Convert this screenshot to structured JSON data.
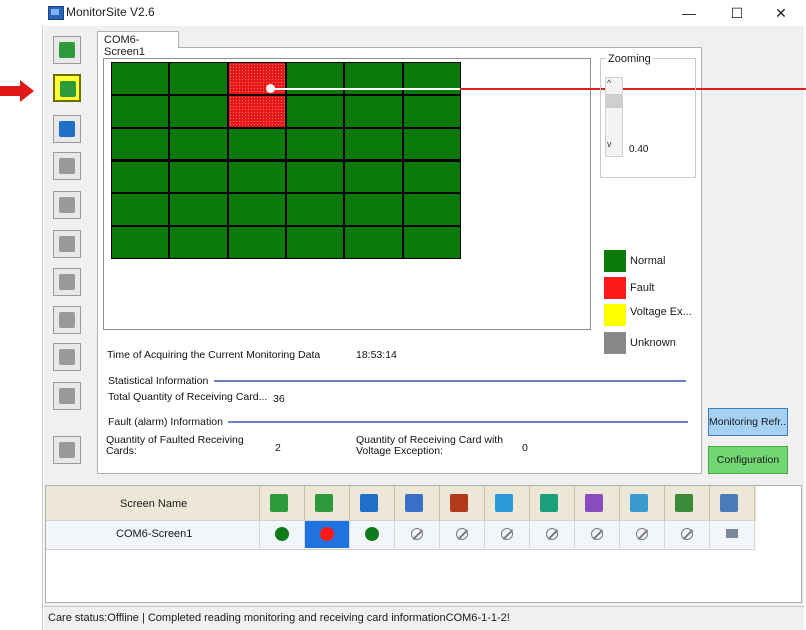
{
  "window": {
    "title": "MonitorSite V2.6",
    "minimize": "—",
    "maximize": "☐",
    "close": "✕"
  },
  "tabs": [
    {
      "label": "COM6-Screen1",
      "active": true
    }
  ],
  "toolbar": {
    "buttons": [
      {
        "name": "receiving-card",
        "color": "#2e9b3a",
        "active": false
      },
      {
        "name": "monitoring-card",
        "color": "#2e9b3a",
        "active": true
      },
      {
        "name": "temperature",
        "color": "#1e6fc8",
        "active": false
      },
      {
        "name": "cabinet-door",
        "color": "#9a9a9a",
        "active": false
      },
      {
        "name": "humidity",
        "color": "#9a9a9a",
        "active": false
      },
      {
        "name": "smoke",
        "color": "#9a9a9a",
        "active": false
      },
      {
        "name": "fan",
        "color": "#9a9a9a",
        "active": false
      },
      {
        "name": "voltage",
        "color": "#9a9a9a",
        "active": false
      },
      {
        "name": "magnet",
        "color": "#9a9a9a",
        "active": false
      },
      {
        "name": "exit",
        "color": "#9a9a9a",
        "active": false
      },
      {
        "name": "module",
        "color": "#9a9a9a",
        "active": false
      }
    ]
  },
  "grid": {
    "rows": 6,
    "cols": 6,
    "fault_cells": [
      [
        0,
        2
      ],
      [
        1,
        2
      ]
    ]
  },
  "zoom": {
    "label": "Zooming",
    "value": "0.40",
    "up": "^",
    "down": "v"
  },
  "legend": [
    {
      "label": "Normal",
      "color": "#0b7a0b"
    },
    {
      "label": "Fault",
      "color": "#ff1a1a"
    },
    {
      "label": "Voltage Ex...",
      "color": "#ffff00"
    },
    {
      "label": "Unknown",
      "color": "#888888"
    }
  ],
  "info": {
    "time_label": "Time of Acquiring the Current Monitoring Data",
    "time_value": "18:53:14",
    "stat_title": "Statistical Information",
    "total_label": "Total Quantity of Receiving Card...",
    "total_value": "36",
    "fault_title": "Fault (alarm) Information",
    "faulted_label_1": "Quantity of Faulted Receiving",
    "faulted_label_2": "Cards:",
    "faulted_value": "2",
    "voltage_label_1": "Quantity of Receiving Card with",
    "voltage_label_2": "Voltage Exception:",
    "voltage_value": "0"
  },
  "buttons": {
    "monitoring_refresh": "Monitoring Refr...",
    "configuration": "Configuration"
  },
  "table": {
    "screen_name_header": "Screen Name",
    "columns": [
      {
        "icon": "receiving-card-icon",
        "color": "#2e9b3a"
      },
      {
        "icon": "monitoring-card-icon",
        "color": "#2e9b3a"
      },
      {
        "icon": "temperature-icon",
        "color": "#1e6fc8"
      },
      {
        "icon": "cabinet-door-icon",
        "color": "#3a6fc8"
      },
      {
        "icon": "smoke-icon",
        "color": "#b03a1a"
      },
      {
        "icon": "fan-icon",
        "color": "#2a9ad8"
      },
      {
        "icon": "voltage-icon",
        "color": "#1aa07a"
      },
      {
        "icon": "magnet-icon",
        "color": "#8a4ac0"
      },
      {
        "icon": "exit-icon",
        "color": "#3a9ad0"
      },
      {
        "icon": "module-icon",
        "color": "#3a8a3a"
      },
      {
        "icon": "globe-icon",
        "color": "#4a7ab8"
      }
    ],
    "rows": [
      {
        "screen_name": "COM6-Screen1",
        "statuses": [
          "ok",
          "fault-selected",
          "ok",
          "none",
          "none",
          "none",
          "none",
          "none",
          "none",
          "none",
          "monitor"
        ]
      }
    ]
  },
  "status_bar": "Care status:Offline  |  Completed reading monitoring and receiving card informationCOM6-1-1-2!"
}
